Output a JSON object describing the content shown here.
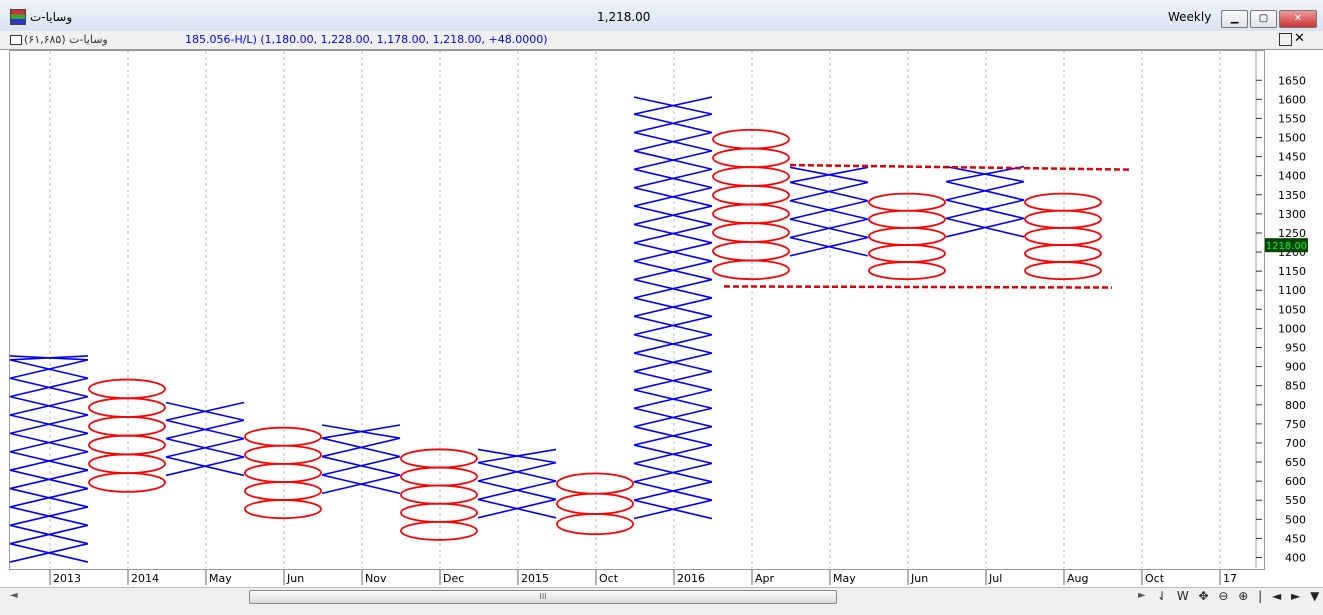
{
  "window": {
    "title": "وسایا-ت",
    "last_price": "1,218.00",
    "period": "Weekly",
    "min_icon": "minimize-icon",
    "max_icon": "maximize-icon",
    "close_icon": "close-icon"
  },
  "info_bar": {
    "symbol": "(۶۱,۶۸۵) وسایا-ت",
    "values": "185.056-H/L) (1,180.00, 1,228.00, 1,178.00, 1,218.00, +48.0000)"
  },
  "colors": {
    "x_column": "#0000ff",
    "o_column": "#ff0000",
    "trendline": "#dd0000",
    "price_label_bg": "#004400",
    "price_label_fg": "#00ff00",
    "grid": "#bbbbbb"
  },
  "chart_data": {
    "type": "point-and-figure",
    "box_size": 48.15,
    "price_axis_ticks": [
      400,
      450,
      500,
      550,
      600,
      650,
      700,
      750,
      800,
      850,
      900,
      950,
      1000,
      1050,
      1100,
      1150,
      1200,
      1250,
      1300,
      1350,
      1400,
      1450,
      1500,
      1550,
      1600,
      1650
    ],
    "date_axis_labels": [
      "2013",
      "2014",
      "May",
      "Jun",
      "Nov",
      "Dec",
      "2015",
      "Oct",
      "2016",
      "Apr",
      "May",
      "Jun",
      "Jul",
      "Aug",
      "Oct",
      "17"
    ],
    "current_price_label": "1218.00",
    "columns": [
      {
        "type": "X",
        "low": 388,
        "high": 928
      },
      {
        "type": "O",
        "low": 572,
        "high": 866
      },
      {
        "type": "X",
        "low": 615,
        "high": 806
      },
      {
        "type": "O",
        "low": 503,
        "high": 740
      },
      {
        "type": "X",
        "low": 568,
        "high": 747
      },
      {
        "type": "O",
        "low": 446,
        "high": 683
      },
      {
        "type": "X",
        "low": 504,
        "high": 683
      },
      {
        "type": "O",
        "low": 461,
        "high": 620
      },
      {
        "type": "X",
        "low": 502,
        "high": 1606
      },
      {
        "type": "O",
        "low": 1129,
        "high": 1520
      },
      {
        "type": "X",
        "low": 1190,
        "high": 1422
      },
      {
        "type": "O",
        "low": 1129,
        "high": 1353
      },
      {
        "type": "X",
        "low": 1240,
        "high": 1424
      },
      {
        "type": "O",
        "low": 1129,
        "high": 1353
      }
    ],
    "trendlines": [
      {
        "from": [
          "2016-05",
          1428
        ],
        "to": [
          "2016-10",
          1416
        ]
      },
      {
        "from": [
          "2016-03",
          1110
        ],
        "to": [
          "2016-09",
          1107
        ]
      }
    ],
    "grid": true
  },
  "scroll": {
    "thumb_glyph": "III",
    "left_arrow": "◄",
    "right_arrow": "►",
    "nav_glyphs": "⇃ W ✥ ⊖ ⊕ | ◄ ► ▼"
  }
}
